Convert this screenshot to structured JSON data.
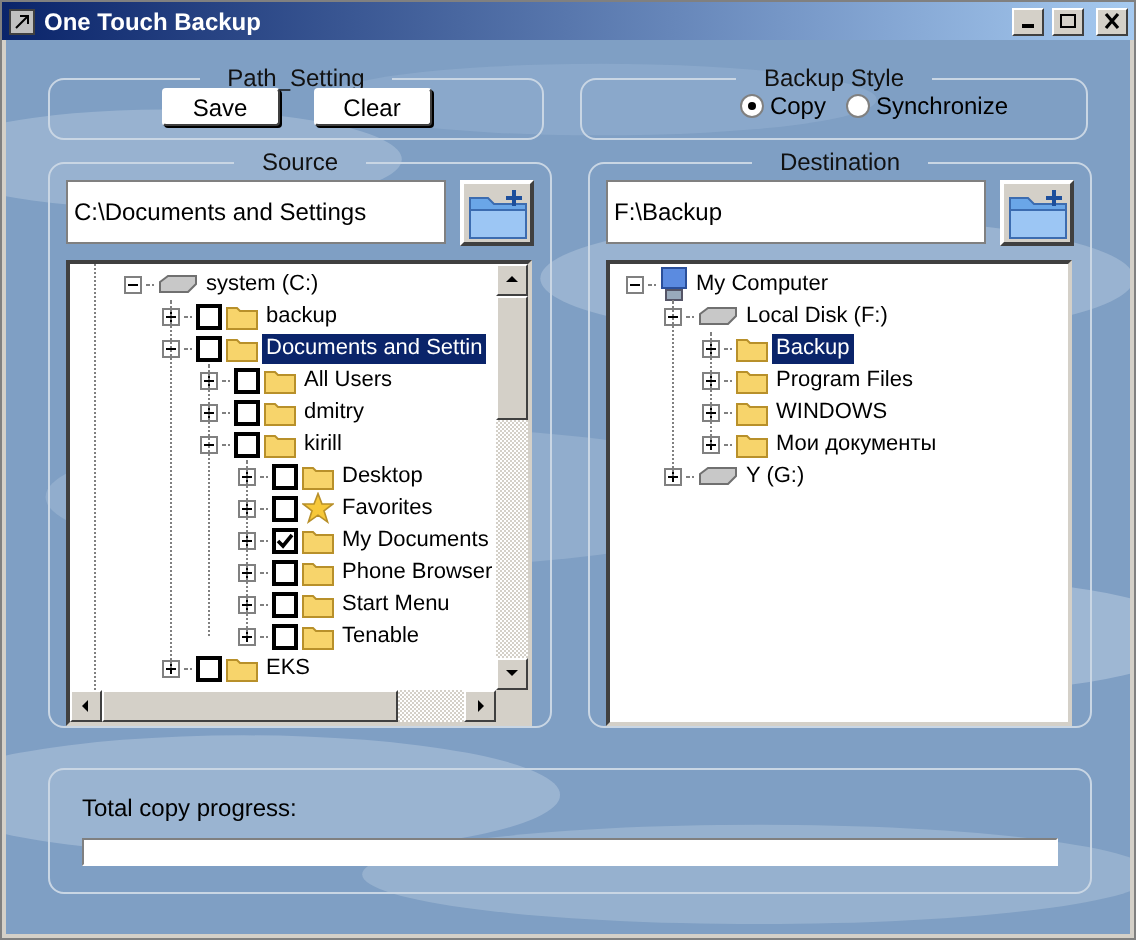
{
  "window": {
    "title": "One Touch Backup"
  },
  "path_setting": {
    "title": "Path_Setting",
    "buttons": [
      "Save",
      "Clear"
    ]
  },
  "backup_style": {
    "title": "Backup Style",
    "options": [
      {
        "label": "Copy",
        "selected": true
      },
      {
        "label": "Synchronize",
        "selected": false
      }
    ]
  },
  "source": {
    "title": "Source",
    "path": "C:\\Documents and Settings",
    "tree": [
      {
        "label": "system (C:)",
        "kind": "drive",
        "expanded": true,
        "selected": false,
        "children": [
          {
            "label": "backup",
            "kind": "folder",
            "checked": false,
            "expanded": false,
            "selected": false
          },
          {
            "label": "Documents and Settin",
            "kind": "folder",
            "checked": false,
            "expanded": true,
            "selected": true,
            "children": [
              {
                "label": "All Users",
                "kind": "folder",
                "checked": false,
                "expanded": false,
                "selected": false
              },
              {
                "label": "dmitry",
                "kind": "folder",
                "checked": false,
                "expanded": false,
                "selected": false
              },
              {
                "label": "kirill",
                "kind": "folder",
                "checked": false,
                "expanded": true,
                "selected": false,
                "children": [
                  {
                    "label": "Desktop",
                    "kind": "folder",
                    "checked": false,
                    "expanded": false,
                    "selected": false
                  },
                  {
                    "label": "Favorites",
                    "kind": "favorites",
                    "checked": false,
                    "expanded": false,
                    "selected": false
                  },
                  {
                    "label": "My Documents",
                    "kind": "folder",
                    "checked": true,
                    "expanded": false,
                    "selected": false
                  },
                  {
                    "label": "Phone Browser",
                    "kind": "folder",
                    "checked": false,
                    "expanded": false,
                    "selected": false
                  },
                  {
                    "label": "Start Menu",
                    "kind": "folder",
                    "checked": false,
                    "expanded": false,
                    "selected": false
                  },
                  {
                    "label": "Tenable",
                    "kind": "folder",
                    "checked": false,
                    "expanded": false,
                    "selected": false
                  }
                ]
              }
            ]
          },
          {
            "label": "EKS",
            "kind": "folder",
            "checked": false,
            "expanded": false,
            "selected": false
          }
        ]
      }
    ]
  },
  "destination": {
    "title": "Destination",
    "path": "F:\\Backup",
    "tree": [
      {
        "label": "My Computer",
        "kind": "computer",
        "expanded": true,
        "selected": false,
        "children": [
          {
            "label": "Local Disk (F:)",
            "kind": "drive",
            "expanded": true,
            "selected": false,
            "children": [
              {
                "label": "Backup",
                "kind": "folder",
                "expanded": false,
                "selected": true
              },
              {
                "label": "Program Files",
                "kind": "folder",
                "expanded": false,
                "selected": false
              },
              {
                "label": "WINDOWS",
                "kind": "folder",
                "expanded": false,
                "selected": false
              },
              {
                "label": "Мои документы",
                "kind": "folder",
                "expanded": false,
                "selected": false
              }
            ]
          },
          {
            "label": "Y (G:)",
            "kind": "drive",
            "expanded": false,
            "selected": false
          }
        ]
      }
    ]
  },
  "progress": {
    "label": "Total copy progress:",
    "level": 0
  }
}
